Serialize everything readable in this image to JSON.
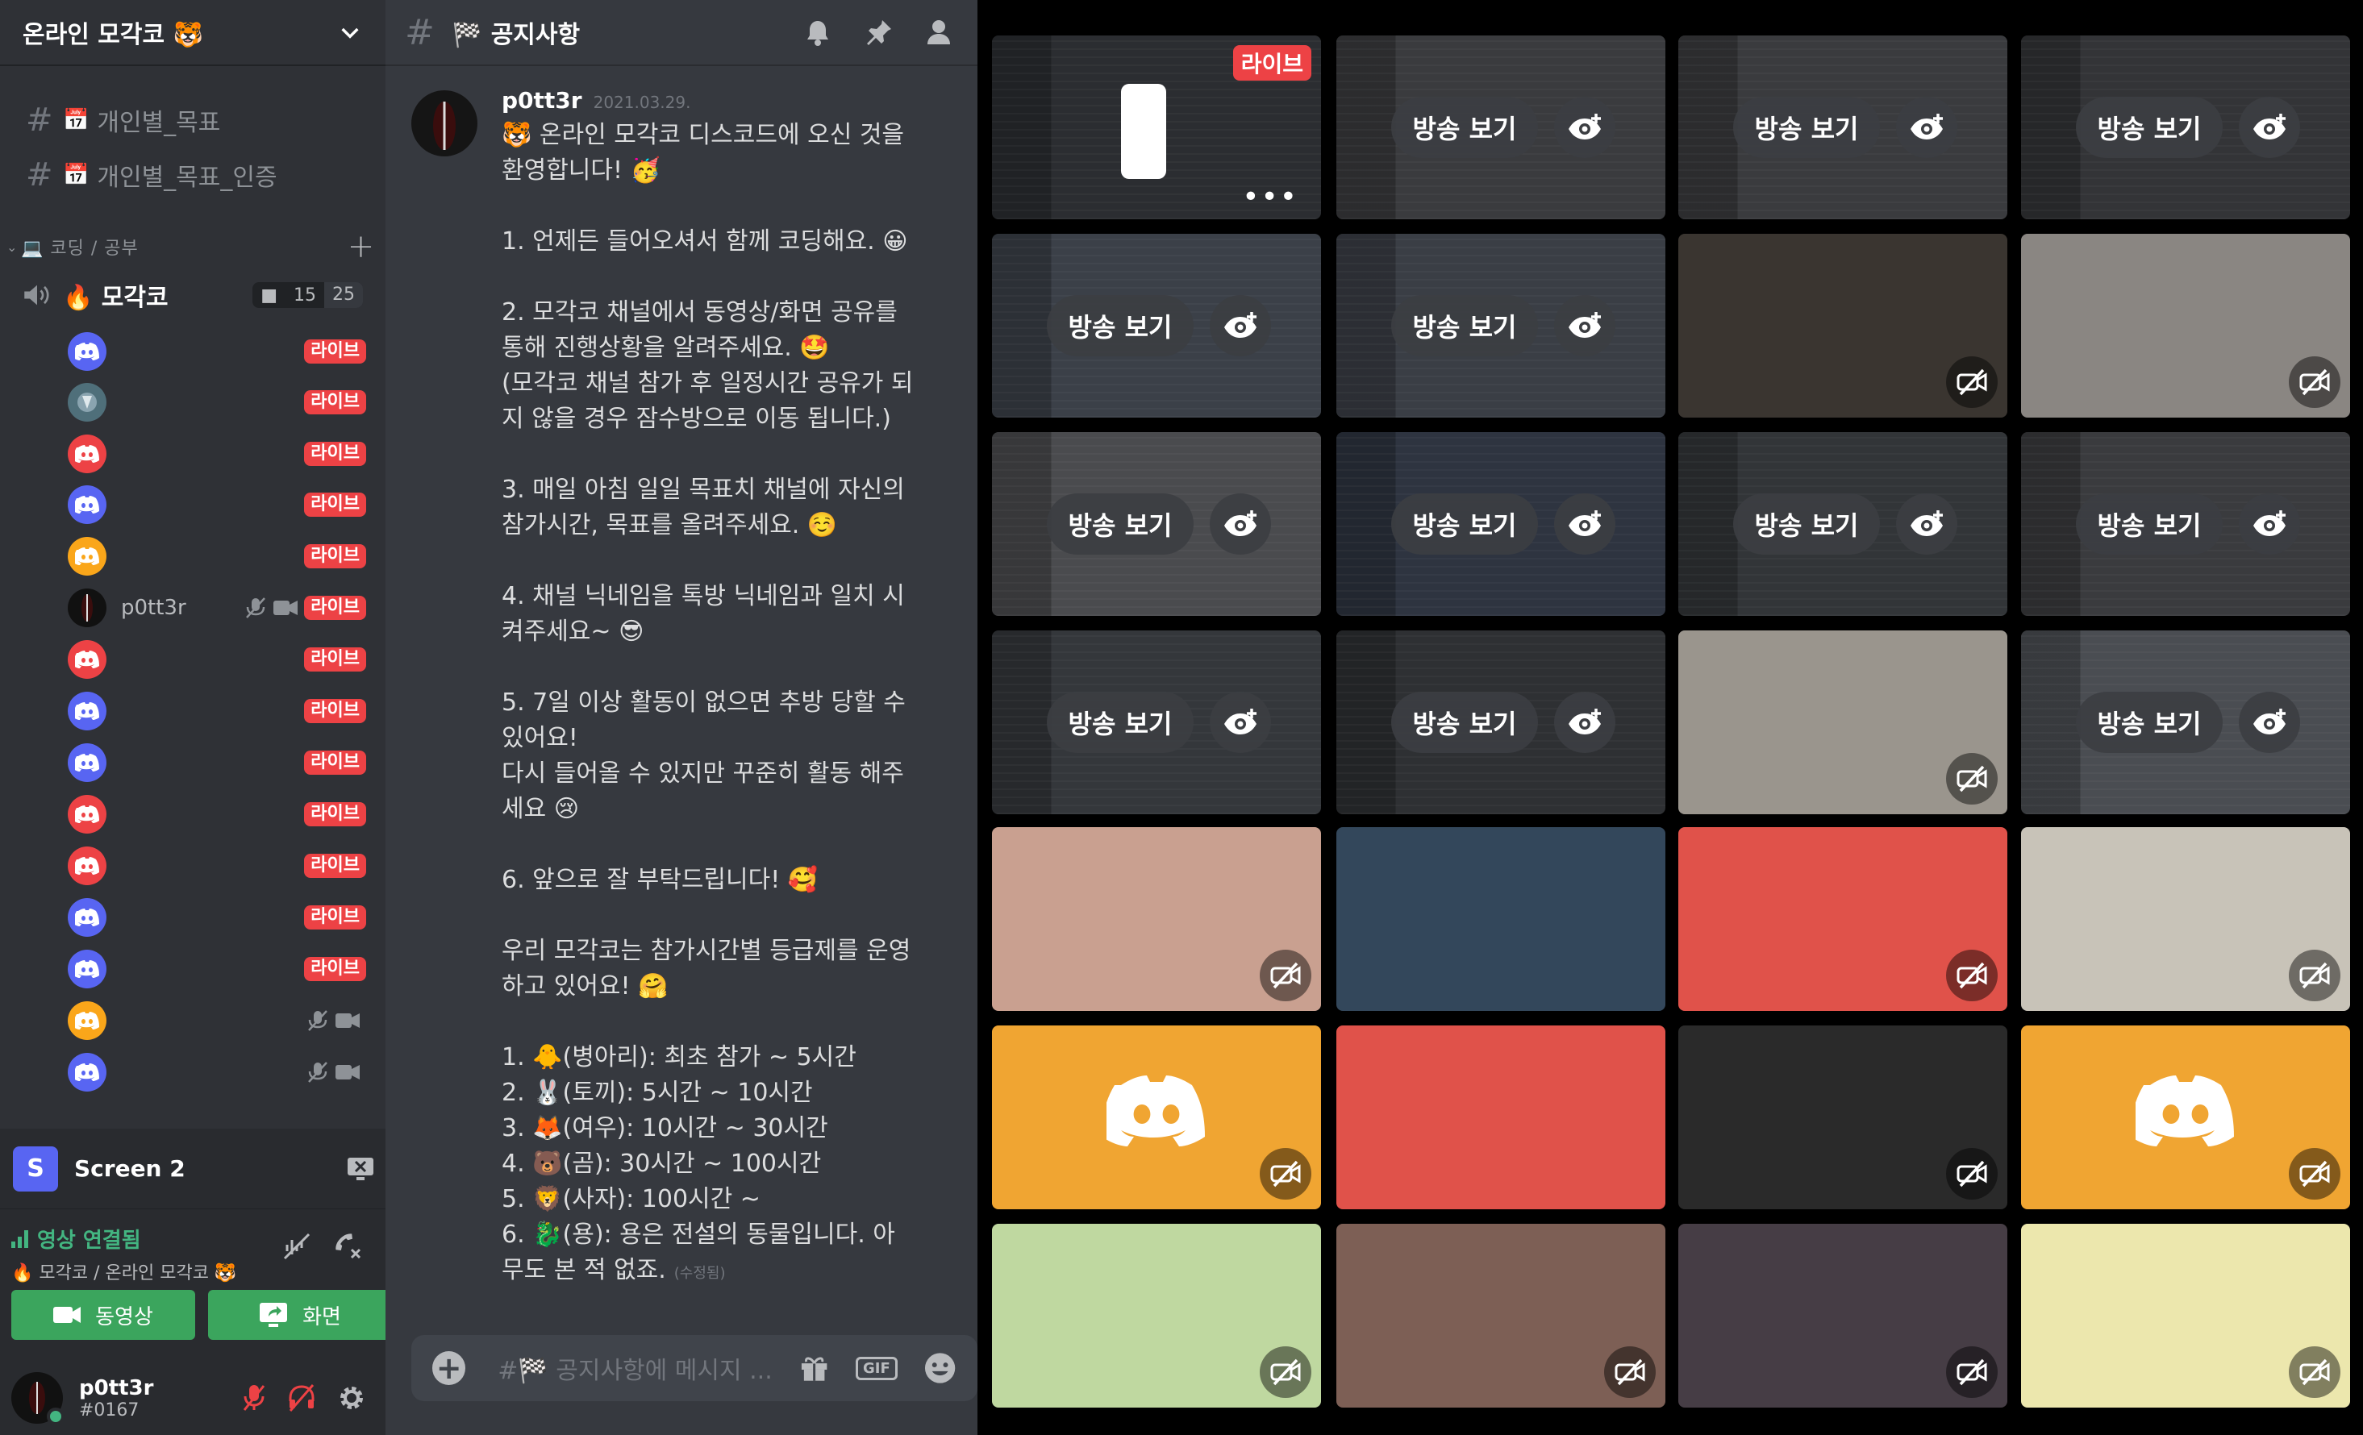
{
  "server": {
    "name": "온라인 모각코 🐯"
  },
  "channels": [
    {
      "name": "개인별_목표",
      "flag": "📅"
    },
    {
      "name": "개인별_목표_인증",
      "flag": "📅"
    }
  ],
  "category": {
    "label": "코딩 / 공부"
  },
  "voice_channel": {
    "name": "🔥 모각코",
    "video_count": "15",
    "user_limit": "25"
  },
  "members": [
    {
      "name": "",
      "live": "라이브",
      "color": "#5865f2"
    },
    {
      "name": "",
      "live": "라이브",
      "color": "#4f6f7a"
    },
    {
      "name": "",
      "live": "라이브",
      "color": "#ed4245"
    },
    {
      "name": "",
      "live": "라이브",
      "color": "#5865f2"
    },
    {
      "name": "",
      "live": "라이브",
      "color": "#faa61a"
    },
    {
      "name": "p0tt3r",
      "live": "라이브",
      "color": "#111111"
    },
    {
      "name": "",
      "live": "라이브",
      "color": "#ed4245"
    },
    {
      "name": "",
      "live": "라이브",
      "color": "#5865f2"
    },
    {
      "name": "",
      "live": "라이브",
      "color": "#5865f2"
    },
    {
      "name": "",
      "live": "라이브",
      "color": "#ed4245"
    },
    {
      "name": "",
      "live": "라이브",
      "color": "#ed4245"
    },
    {
      "name": "",
      "live": "라이브",
      "color": "#5865f2"
    },
    {
      "name": "",
      "live": "라이브",
      "color": "#5865f2"
    },
    {
      "name": "",
      "live": "",
      "color": "#faa61a"
    },
    {
      "name": "",
      "live": "",
      "color": "#5865f2"
    }
  ],
  "stream_panel": {
    "label": "Screen 2",
    "icon_letter": "S"
  },
  "voice_status": {
    "connected": "영상 연결됨",
    "location": "🔥 모각코 / 온라인 모각코 🐯"
  },
  "buttons": {
    "video": "동영상",
    "screen": "화면"
  },
  "user": {
    "name": "p0tt3r",
    "tag": "#0167"
  },
  "chat": {
    "channel_name": "공지사항",
    "author": "p0tt3r",
    "date": "2021.03.29.",
    "lines": [
      "🐯 온라인 모각코 디스코드에 오신 것을",
      "환영합니다! 🥳",
      "1. 언제든 들어오셔서 함께 코딩해요. 😀",
      "2. 모각코 채널에서 동영상/화면 공유를",
      "통해 진행상황을 알려주세요. 🤩",
      "(모각코 채널 참가 후 일정시간 공유가 되",
      "지 않을 경우 잠수방으로 이동 됩니다.)",
      "3. 매일 아침 일일 목표치 채널에 자신의",
      "참가시간, 목표를 올려주세요. ☺️",
      "4. 채널 닉네임을 톡방 닉네임과 일치 시",
      "켜주세요~ 😎",
      "5. 7일 이상 활동이 없으면 추방 당할 수",
      "있어요!",
      "다시 들어올 수 있지만 꾸준히 활동 해주",
      "세요 😢",
      "6. 앞으로 잘 부탁드립니다! 🥰",
      "우리 모각코는 참가시간별 등급제를 운영",
      "하고 있어요! 🤗",
      "1. 🐥(병아리): 최초 참가 ~ 5시간",
      "2. 🐰(토끼): 5시간 ~ 10시간",
      "3. 🦊(여우): 10시간 ~ 30시간",
      "4. 🐻(곰): 30시간 ~ 100시간",
      "5. 🦁(사자): 100시간 ~",
      "6. 🐉(용): 용은 전설의 동물입니다. 아",
      "무도 본 적 없죠."
    ],
    "edited": "(수정됨)",
    "input_placeholder": "#🏁 공지사항에 메시지 ...",
    "gif_label": "GIF"
  },
  "grid": {
    "watch_label": "방송 보기",
    "live_label": "라이브",
    "tiles": [
      {
        "kind": "live",
        "bg": "#2b2d31"
      },
      {
        "kind": "watch",
        "bg": "#3a3b3e"
      },
      {
        "kind": "watch",
        "bg": "#3a3b3e"
      },
      {
        "kind": "watch",
        "bg": "#333437"
      },
      {
        "kind": "watch",
        "bg": "#3b4048"
      },
      {
        "kind": "watch",
        "bg": "#3a3e45"
      },
      {
        "kind": "cam",
        "bg": "#3a3530"
      },
      {
        "kind": "cam",
        "bg": "#8a8682"
      },
      {
        "kind": "watch",
        "bg": "#4a4b4e"
      },
      {
        "kind": "watch",
        "bg": "#2e3440"
      },
      {
        "kind": "watch",
        "bg": "#323538"
      },
      {
        "kind": "watch",
        "bg": "#3a3b3e"
      },
      {
        "kind": "watch",
        "bg": "#34373b"
      },
      {
        "kind": "watch",
        "bg": "#2e3033"
      },
      {
        "kind": "cam",
        "bg": "#9a958d"
      },
      {
        "kind": "watch",
        "bg": "#4a4d52"
      },
      {
        "kind": "color",
        "bg": "#c9a090"
      },
      {
        "kind": "color",
        "bg": "#33475b"
      },
      {
        "kind": "color",
        "bg": "#e0524a"
      },
      {
        "kind": "color",
        "bg": "#c8c3b8"
      },
      {
        "kind": "logo",
        "bg": "#f0a532"
      },
      {
        "kind": "color",
        "bg": "#e0524a"
      },
      {
        "kind": "color",
        "bg": "#2a2a2a"
      },
      {
        "kind": "logo",
        "bg": "#f0a532"
      },
      {
        "kind": "color",
        "bg": "#bfd8a0"
      },
      {
        "kind": "color",
        "bg": "#7d5f55"
      },
      {
        "kind": "color",
        "bg": "#463d45"
      },
      {
        "kind": "color",
        "bg": "#ece7ad"
      }
    ]
  }
}
